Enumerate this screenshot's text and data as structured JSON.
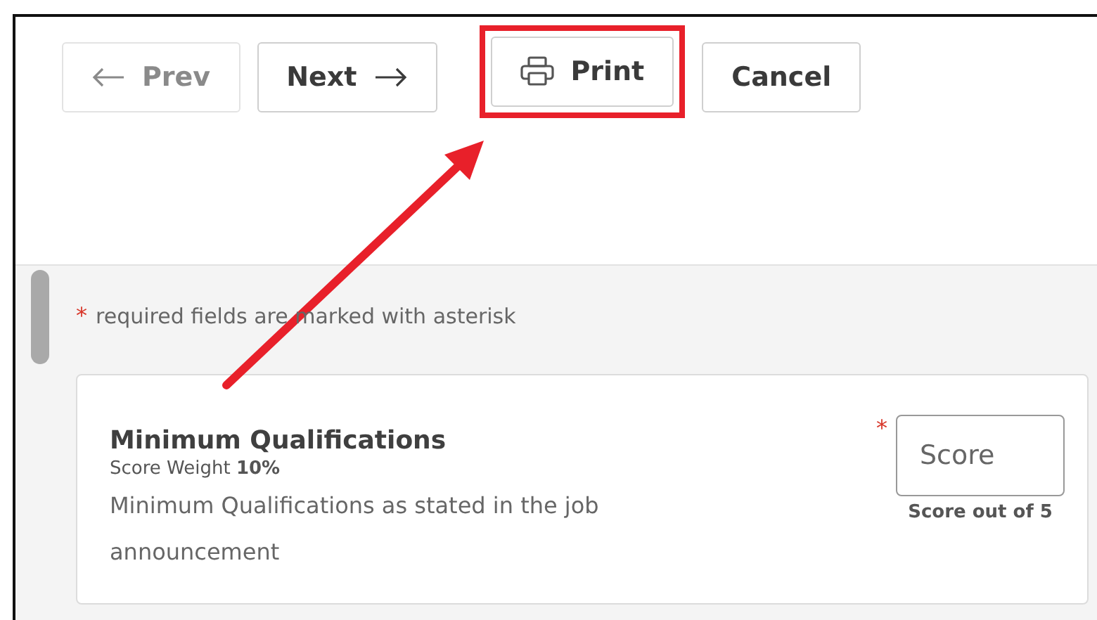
{
  "toolbar": {
    "buttons": [
      {
        "label": "Prev",
        "kind": "prev",
        "disabled": true,
        "highlighted": false
      },
      {
        "label": "Next",
        "kind": "next",
        "disabled": false,
        "highlighted": false
      },
      {
        "label": "Print",
        "kind": "print",
        "disabled": false,
        "highlighted": true
      },
      {
        "label": "Cancel",
        "kind": "plain",
        "disabled": false,
        "highlighted": false
      }
    ]
  },
  "form": {
    "required_mark": "*",
    "required_note": "required fields are marked with asterisk",
    "criteria": [
      {
        "title": "Minimum Qualifications",
        "weight_label": "Score Weight **10%**",
        "description": "Minimum Qualifications as stated in the job announcement",
        "required": true,
        "score_placeholder": "Score",
        "score_hint": "Score out of 5"
      }
    ]
  }
}
